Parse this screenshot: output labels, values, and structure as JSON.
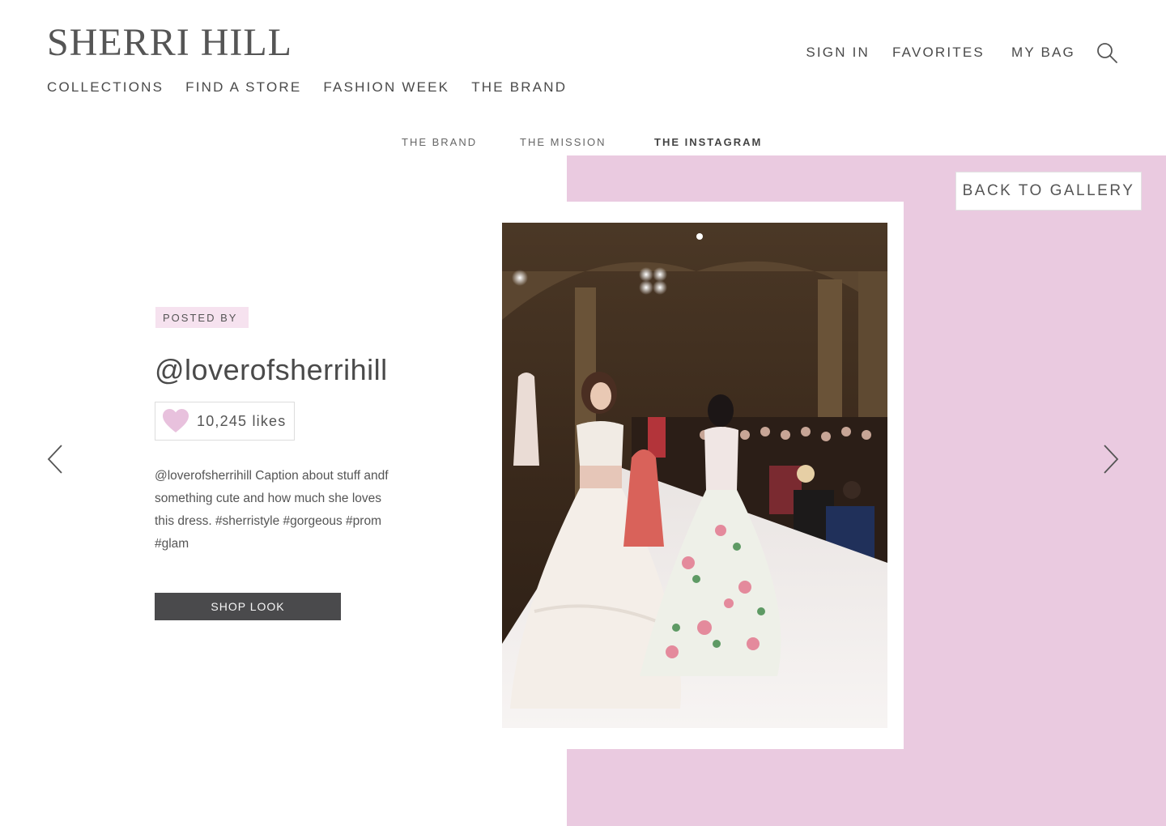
{
  "header": {
    "logo": "SHERRI HILL",
    "nav": [
      {
        "label": "COLLECTIONS"
      },
      {
        "label": "FIND A STORE"
      },
      {
        "label": "FASHION WEEK"
      },
      {
        "label": "THE BRAND"
      }
    ],
    "utility": {
      "sign_in": "SIGN IN",
      "favorites": "FAVORITES",
      "bag": "MY BAG",
      "search_icon": "search-icon"
    }
  },
  "subnav": {
    "items": [
      {
        "label": "THE BRAND",
        "active": false
      },
      {
        "label": "THE MISSION",
        "active": false
      },
      {
        "label": "THE INSTAGRAM",
        "active": true
      }
    ]
  },
  "post": {
    "posted_by_label": "POSTED BY",
    "username": "@loverofsherrihill",
    "likes": "10,245 likes",
    "caption": "@loverofsherrihill Caption about stuff andf something cute and how much she loves this dress. #sherristyle #gorgeous #prom #glam",
    "shop_label": "SHOP LOOK",
    "heart_icon": "heart-icon"
  },
  "gallery": {
    "back_label": "BACK TO GALLERY",
    "prev_icon": "chevron-left-icon",
    "next_icon": "chevron-right-icon"
  },
  "colors": {
    "accent_pink": "#eacae0",
    "tag_pink": "#f6e2ef",
    "heart_pink": "#e8c1dd",
    "button_dark": "#4a4a4c",
    "text": "#4a4a4a"
  }
}
